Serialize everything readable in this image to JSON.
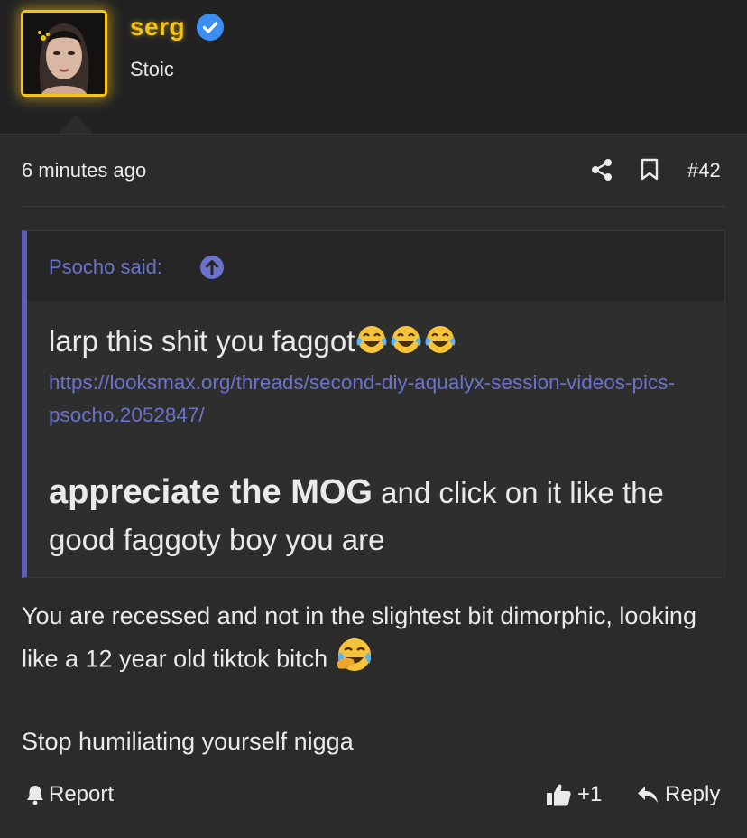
{
  "post": {
    "author": {
      "username": "serg",
      "user_title": "Stoic",
      "verified": true,
      "username_color": "#f3c21b"
    },
    "timestamp": "6 minutes ago",
    "post_number": "#42",
    "icons": [
      "share-icon",
      "bookmark-icon"
    ],
    "quote": {
      "author_label": "Psocho said:",
      "line1_text": "larp this shit you faggot",
      "line1_emojis": [
        "laughing-crying-emoji",
        "laughing-crying-emoji",
        "laughing-crying-emoji"
      ],
      "link": "https://looksmax.org/threads/second-diy-aqualyx-session-videos-pics-psocho.2052847/",
      "line3_bold": "appreciate the MOG",
      "line3_rest": " and click on it like the good faggoty boy you are"
    },
    "message": {
      "para1": "You are recessed and not in the slightest bit dimorphic, looking like a 12 year old tiktok bitch ",
      "para1_emoji": "facepalm-crying-emoji",
      "para2": "Stop humiliating yourself nigga"
    },
    "actions": {
      "report_label": "Report",
      "like_count": "+1",
      "reply_label": "Reply"
    }
  },
  "colors": {
    "accent_link": "#6b72c9",
    "quote_border": "#5b61b8",
    "verified_badge": "#3b8ff0"
  }
}
